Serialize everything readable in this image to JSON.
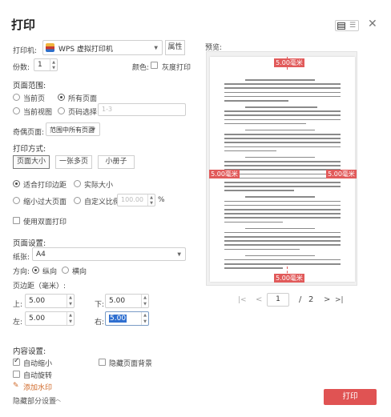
{
  "title": "打印",
  "colors": {
    "accent": "#e05353",
    "tag": "#e15a5a"
  },
  "printer": {
    "label": "打印机:",
    "value": "WPS 虚拟打印机",
    "props_button": "属性"
  },
  "copies": {
    "label": "份数:",
    "value": "1",
    "color_label": "颜色:",
    "grayscale_label": "灰度打印"
  },
  "range": {
    "title": "页面范围:",
    "current_page": "当前页",
    "all_pages": "所有页面",
    "current_view": "当前视图",
    "page_select": "页码选择:",
    "page_placeholder": "1-3",
    "order_label": "奇偶页面:",
    "order_value": "范围中所有页面"
  },
  "mode": {
    "title": "打印方式:",
    "buttons": [
      "页面大小",
      "一张多页",
      "小册子"
    ],
    "fit_margin": "适合打印边距",
    "actual_size": "实际大小",
    "shrink": "缩小过大页面",
    "custom_scale": "自定义比例:",
    "scale_value": "100.00",
    "percent": "%",
    "duplex": "使用双面打印"
  },
  "page_setup": {
    "title": "页面设置:",
    "paper_label": "纸张:",
    "paper_value": "A4",
    "orientation_label": "方向:",
    "portrait": "纵向",
    "landscape": "横向",
    "margin_title": "页边距（毫米）:",
    "top_label": "上:",
    "top_value": "5.00",
    "bottom_label": "下:",
    "bottom_value": "5.00",
    "left_label": "左:",
    "left_value": "5.00",
    "right_label": "右:",
    "right_value": "5.00"
  },
  "content": {
    "title": "内容设置:",
    "autofit": "自动缩小",
    "hide_bg": "隐藏页面背景",
    "auto_rotate": "自动旋转",
    "watermark": "添加水印",
    "hide_settings": "隐藏部分设置"
  },
  "preview": {
    "label": "预览:",
    "margin_tag": "5.00毫米",
    "page_current": "1",
    "page_sep": "/",
    "page_total": "2"
  },
  "print_button": "打印"
}
